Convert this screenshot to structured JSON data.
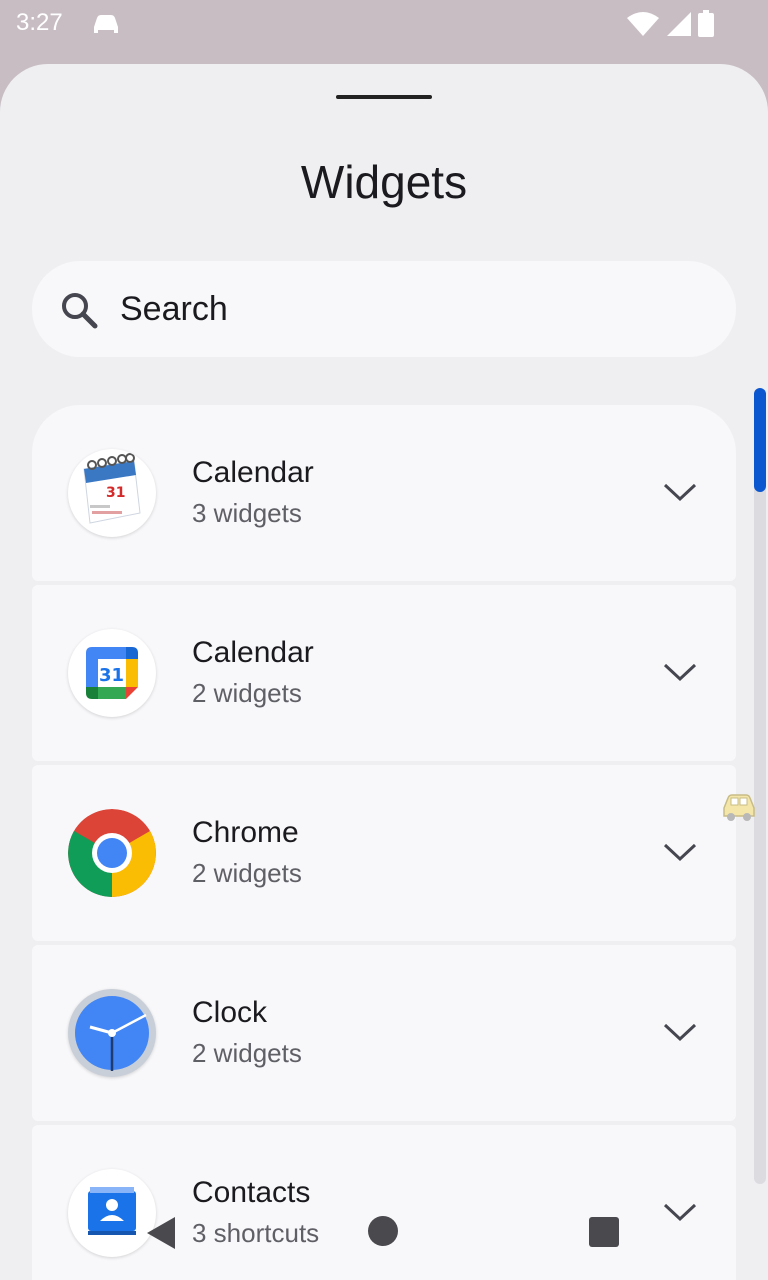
{
  "status_bar": {
    "time": "3:27",
    "icons": [
      "notification-car-icon",
      "wifi-icon",
      "signal-icon",
      "battery-icon"
    ]
  },
  "sheet": {
    "title": "Widgets",
    "search": {
      "placeholder": "Search",
      "icon": "search-icon"
    }
  },
  "apps": [
    {
      "name": "Calendar",
      "subtitle": "3 widgets",
      "icon": "calendar-classic-icon"
    },
    {
      "name": "Calendar",
      "subtitle": "2 widgets",
      "icon": "google-calendar-icon"
    },
    {
      "name": "Chrome",
      "subtitle": "2 widgets",
      "icon": "chrome-icon"
    },
    {
      "name": "Clock",
      "subtitle": "2 widgets",
      "icon": "clock-icon"
    },
    {
      "name": "Contacts",
      "subtitle": "3 shortcuts",
      "icon": "contacts-icon"
    }
  ],
  "colors": {
    "accent": "#0b57d0",
    "sheet_bg": "#efeff2",
    "card_bg": "#f8f8fa"
  },
  "nav_bar": {
    "icons": [
      "back-icon",
      "home-icon",
      "recents-icon"
    ]
  }
}
